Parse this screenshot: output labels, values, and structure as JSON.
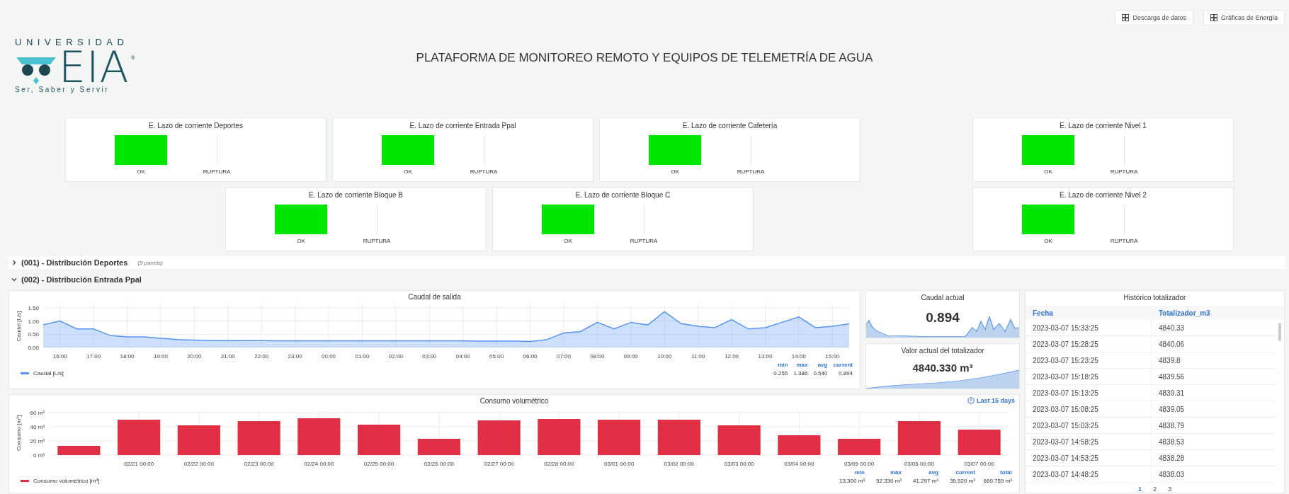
{
  "header_buttons": [
    {
      "label": "Descarga de datos"
    },
    {
      "label": "Gráficas de Energía"
    }
  ],
  "logo": {
    "top_text": "UNIVERSIDAD",
    "mark_text": "EIA",
    "registered": "®",
    "motto": "Ser, Saber y Servir"
  },
  "title": "PLATAFORMA DE MONITOREO REMOTO Y EQUIPOS DE TELEMETRÍA DE AGUA",
  "status_rows": [
    {
      "panels": [
        {
          "title": "E. Lazo de corriente Deportes",
          "states": [
            {
              "label": "OK",
              "active": true
            },
            {
              "label": "RUPTURA",
              "active": false
            }
          ]
        },
        {
          "title": "E. Lazo de corriente Entrada Ppal",
          "states": [
            {
              "label": "OK",
              "active": true
            },
            {
              "label": "RUPTURA",
              "active": false
            }
          ]
        },
        {
          "title": "E. Lazo de corriente Cafetería",
          "states": [
            {
              "label": "OK",
              "active": true
            },
            {
              "label": "RUPTURA",
              "active": false
            }
          ]
        },
        {
          "title": "E. Lazo de corriente Nivel 1",
          "states": [
            {
              "label": "OK",
              "active": true
            },
            {
              "label": "RUPTURA",
              "active": false
            }
          ]
        }
      ]
    },
    {
      "panels": [
        {
          "title": "E. Lazo de corriente Bloque B",
          "states": [
            {
              "label": "OK",
              "active": true
            },
            {
              "label": "RUPTURA",
              "active": false
            }
          ]
        },
        {
          "title": "E. Lazo de corriente Bloque C",
          "states": [
            {
              "label": "OK",
              "active": true
            },
            {
              "label": "RUPTURA",
              "active": false
            }
          ]
        },
        {
          "title": "E. Lazo de corriente Nivel 2",
          "states": [
            {
              "label": "OK",
              "active": true
            },
            {
              "label": "RUPTURA",
              "active": false
            }
          ]
        }
      ]
    }
  ],
  "sections": [
    {
      "title": "(001) - Distribución Deportes",
      "expanded": false,
      "note": "(9 panels)"
    },
    {
      "title": "(002) - Distribución Entrada Ppal",
      "expanded": true
    }
  ],
  "flow_panel": {
    "title": "Caudal de salida",
    "chart_data": {
      "type": "area",
      "ylabel": "Caudal [L/s]",
      "categories": [
        null,
        "16:00",
        null,
        "17:00",
        null,
        "18:00",
        null,
        "19:00",
        null,
        "20:00",
        null,
        "21:00",
        null,
        "22:00",
        null,
        "23:00",
        null,
        "00:00",
        null,
        "01:00",
        null,
        "02:00",
        null,
        "03:00",
        null,
        "04:00",
        null,
        "05:00",
        null,
        "06:00",
        null,
        "07:00",
        null,
        "08:00",
        null,
        "09:00",
        null,
        "10:00",
        null,
        "11:00",
        null,
        "12:00",
        null,
        "13:00",
        null,
        "14:00",
        null,
        "15:00",
        null
      ],
      "series": [
        {
          "name": "Caudal [L/s]",
          "color": "#5794f2",
          "values": [
            0.85,
            1.0,
            0.7,
            0.7,
            0.45,
            0.4,
            0.4,
            0.35,
            0.3,
            0.28,
            0.27,
            0.27,
            0.26,
            0.26,
            0.25,
            0.25,
            0.25,
            0.25,
            0.25,
            0.25,
            0.25,
            0.25,
            0.25,
            0.25,
            0.25,
            0.25,
            0.24,
            0.24,
            0.24,
            0.23,
            0.3,
            0.55,
            0.6,
            0.95,
            0.7,
            0.95,
            0.85,
            1.35,
            0.9,
            0.8,
            0.75,
            1.05,
            0.7,
            0.75,
            0.95,
            1.15,
            0.75,
            0.8,
            0.89
          ]
        }
      ],
      "grid": true,
      "ylim": [
        0,
        1.6
      ],
      "yticks": [
        {
          "value": 0,
          "label": "0.00"
        },
        {
          "value": 0.5,
          "label": "0.50"
        },
        {
          "value": 1,
          "label": "1.00"
        },
        {
          "value": 1.5,
          "label": "1.50"
        }
      ]
    },
    "stats": [
      {
        "name": "min",
        "value": "0.255"
      },
      {
        "name": "max",
        "value": "1.386"
      },
      {
        "name": "avg",
        "value": "0.540"
      },
      {
        "name": "current",
        "value": "0.894"
      }
    ]
  },
  "stat_panels": [
    {
      "title": "Caudal actual",
      "value": "0.894",
      "kind": "spiky"
    },
    {
      "title": "Valor actual del totalizador",
      "value": "4840.330 m³",
      "kind": "rising"
    }
  ],
  "volume_panel": {
    "title": "Consumo volumétrico",
    "time_range": "Last 15 days",
    "chart_data": {
      "type": "bar",
      "ylabel": "Consumo [m³]",
      "categories": [
        null,
        "02/21 00:00",
        "02/22 00:00",
        "02/23 00:00",
        "02/24 00:00",
        "02/25 00:00",
        "02/26 00:00",
        "02/27 00:00",
        "02/28 00:00",
        "03/01 00:00",
        "03/02 00:00",
        "03/03 00:00",
        "03/04 00:00",
        "03/05 00:00",
        "03/06 00:00",
        "03/07 00:00"
      ],
      "series": [
        {
          "name": "Consumo volumétrico [m³]",
          "color": "#e02f44",
          "values": [
            13,
            50,
            42,
            48,
            52,
            43,
            23,
            49,
            51,
            50,
            50,
            42,
            28,
            23,
            48,
            36
          ]
        }
      ],
      "grid": true,
      "ylim": [
        0,
        62
      ],
      "yticks": [
        {
          "value": 0,
          "label": "0 m³"
        },
        {
          "value": 20,
          "label": "20 m³"
        },
        {
          "value": 40,
          "label": "40 m³"
        },
        {
          "value": 60,
          "label": "60 m³"
        }
      ]
    },
    "stats": [
      {
        "name": "min",
        "value": "13.300 m³"
      },
      {
        "name": "max",
        "value": "52.330 m³"
      },
      {
        "name": "avg",
        "value": "41.297 m³"
      },
      {
        "name": "current",
        "value": "35.520 m³"
      },
      {
        "name": "total",
        "value": "660.759 m³"
      }
    ]
  },
  "table": {
    "title": "Histórico totalizador",
    "columns": [
      "Fecha",
      "Totalizador_m3"
    ],
    "rows": [
      [
        "2023-03-07 15:33:25",
        "4840.33"
      ],
      [
        "2023-03-07 15:28:25",
        "4840.06"
      ],
      [
        "2023-03-07 15:23:25",
        "4839.8"
      ],
      [
        "2023-03-07 15:18:25",
        "4839.56"
      ],
      [
        "2023-03-07 15:13:25",
        "4839.31"
      ],
      [
        "2023-03-07 15:08:25",
        "4839.05"
      ],
      [
        "2023-03-07 15:03:25",
        "4838.79"
      ],
      [
        "2023-03-07 14:58:25",
        "4838.53"
      ],
      [
        "2023-03-07 14:53:25",
        "4838.28"
      ],
      [
        "2023-03-07 14:48:25",
        "4838.03"
      ]
    ],
    "pages": [
      {
        "label": "1",
        "selected": true
      },
      {
        "label": "2",
        "selected": false
      },
      {
        "label": "3",
        "selected": false
      }
    ]
  }
}
